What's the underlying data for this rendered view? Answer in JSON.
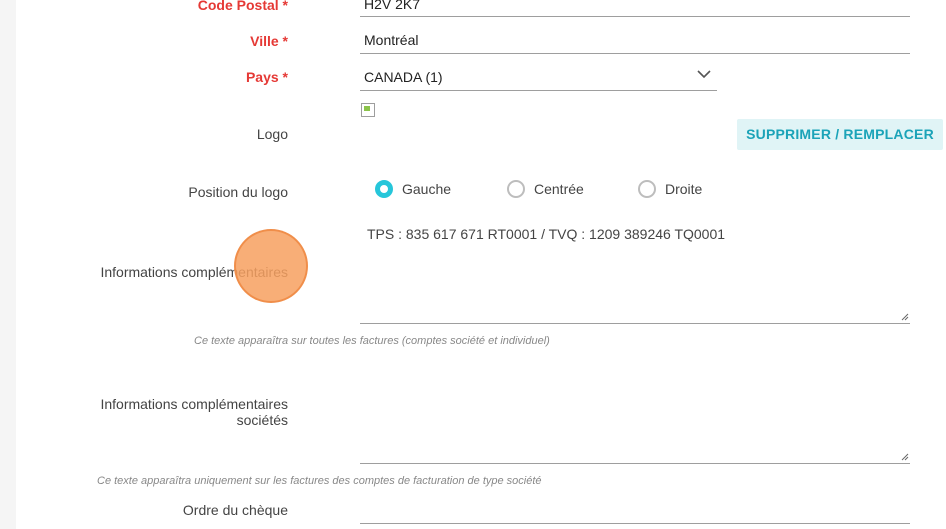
{
  "form": {
    "postal_code": {
      "label": "Code Postal *",
      "value": "H2V 2K7"
    },
    "city": {
      "label": "Ville *",
      "value": "Montréal"
    },
    "country": {
      "label": "Pays *",
      "value": "CANADA (1)"
    },
    "logo": {
      "label": "Logo",
      "button": "SUPPRIMER / REMPLACER"
    },
    "logo_position": {
      "label": "Position du logo",
      "options": [
        {
          "label": "Gauche",
          "checked": true
        },
        {
          "label": "Centrée",
          "checked": false
        },
        {
          "label": "Droite",
          "checked": false
        }
      ]
    },
    "extra_info": {
      "label": "Informations complémentaires",
      "value": "TPS : 835 617 671 RT0001 / TVQ : 1209 389246 TQ0001",
      "hint": "Ce texte apparaîtra sur toutes les factures (comptes société et individuel)"
    },
    "extra_info_company": {
      "label_line1": "Informations complémentaires",
      "label_line2": "sociétés",
      "value": "",
      "hint": "Ce texte apparaîtra uniquement sur les factures des comptes de facturation de type société"
    },
    "cheque_order": {
      "label": "Ordre du chèque",
      "value": ""
    }
  },
  "colors": {
    "required_label": "#e53935",
    "accent": "#26c6da",
    "button_bg": "#e0f4f6",
    "button_text": "#1ba3b8",
    "cursor": "#f7a05f"
  },
  "icons": {
    "select_arrow": "chevron-down-icon",
    "logo_image": "broken-image-icon",
    "resize": "resize-handle-icon"
  }
}
